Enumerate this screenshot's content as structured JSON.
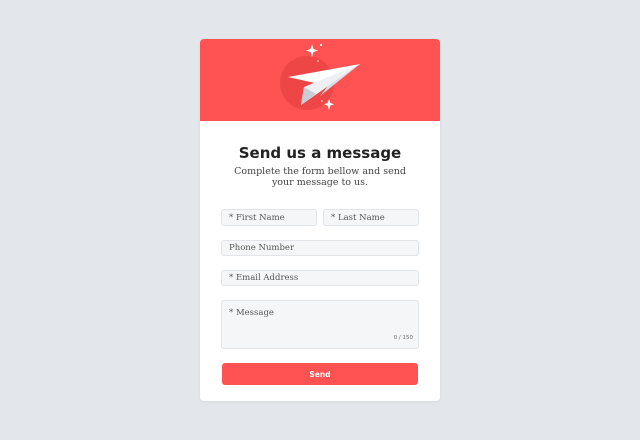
{
  "form": {
    "title": "Send us a message",
    "subtitle": "Complete the form bellow and send your message to us.",
    "first_name_placeholder": "* First Name",
    "last_name_placeholder": "* Last Name",
    "phone_placeholder": "Phone Number",
    "email_placeholder": "* Email Address",
    "message_placeholder": "* Message",
    "message_counter": "0 / 150",
    "send_label": "Send"
  },
  "colors": {
    "accent": "#ff5252",
    "background": "#e3e7eb",
    "card": "#ffffff",
    "field_bg": "#f5f6f8"
  },
  "icons": {
    "hero": "paper-plane-icon",
    "decoration": "sparkle-icon"
  }
}
